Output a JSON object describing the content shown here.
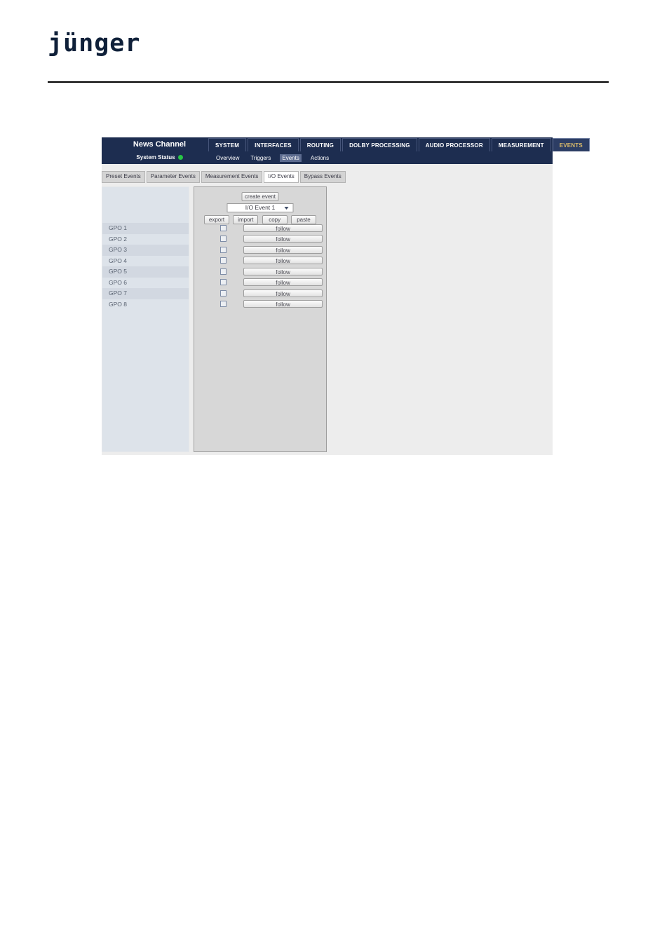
{
  "letterhead": {
    "logo_text": "jünger",
    "logo_color": "#0f2039"
  },
  "webui": {
    "device_name": "News Channel",
    "system_status": {
      "label": "System Status",
      "led_color": "#28c546",
      "led_name": "status-led-green"
    },
    "main_tabs": [
      {
        "label": "SYSTEM",
        "active": false
      },
      {
        "label": "INTERFACES",
        "active": false
      },
      {
        "label": "ROUTING",
        "active": false
      },
      {
        "label": "DOLBY PROCESSING",
        "active": false
      },
      {
        "label": "AUDIO PROCESSOR",
        "active": false
      },
      {
        "label": "MEASUREMENT",
        "active": false
      },
      {
        "label": "EVENTS",
        "active": true
      }
    ],
    "sub_nav": [
      {
        "label": "Overview",
        "active": false
      },
      {
        "label": "Triggers",
        "active": false
      },
      {
        "label": "Events",
        "active": true
      },
      {
        "label": "Actions",
        "active": false
      }
    ],
    "event_tabs": [
      {
        "label": "Preset Events",
        "active": false
      },
      {
        "label": "Parameter Events",
        "active": false
      },
      {
        "label": "Measurement Events",
        "active": false
      },
      {
        "label": "I/O Events",
        "active": true
      },
      {
        "label": "Bypass Events",
        "active": false
      }
    ],
    "controls": {
      "create_event_label": "create event",
      "event_select_value": "I/O Event 1",
      "io_buttons": [
        {
          "label": "export"
        },
        {
          "label": "import"
        },
        {
          "label": "copy"
        },
        {
          "label": "paste"
        }
      ]
    },
    "gpo_rows": [
      {
        "name": "GPO 1",
        "checked": false,
        "action_label": "follow"
      },
      {
        "name": "GPO 2",
        "checked": false,
        "action_label": "follow"
      },
      {
        "name": "GPO 3",
        "checked": false,
        "action_label": "follow"
      },
      {
        "name": "GPO 4",
        "checked": false,
        "action_label": "follow"
      },
      {
        "name": "GPO 5",
        "checked": false,
        "action_label": "follow"
      },
      {
        "name": "GPO 6",
        "checked": false,
        "action_label": "follow"
      },
      {
        "name": "GPO 7",
        "checked": false,
        "action_label": "follow"
      },
      {
        "name": "GPO 8",
        "checked": false,
        "action_label": "follow"
      }
    ],
    "colors": {
      "navbar": "#1d2d50",
      "active_tab_text": "#d8b96a",
      "left_panel": "#dde3ea",
      "center_panel": "#d7d7d7",
      "page_bg": "#ededed"
    }
  }
}
